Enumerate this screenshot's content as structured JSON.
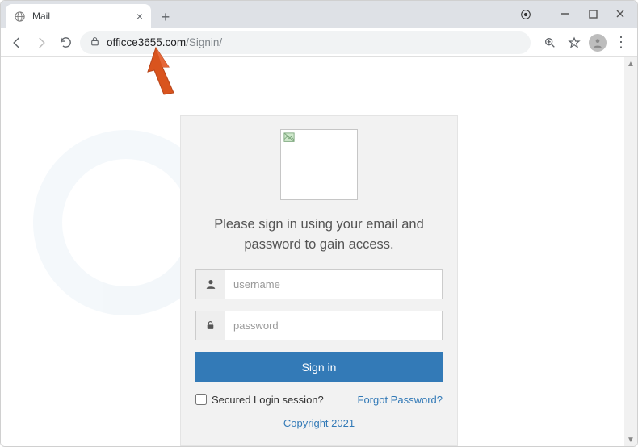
{
  "tab": {
    "title": "Mail"
  },
  "url": {
    "domain": "officce3655.com",
    "path": "/Signin/"
  },
  "page": {
    "heading": "Please sign in using your email and password to gain access.",
    "username_placeholder": "username",
    "password_placeholder": "password",
    "signin_label": "Sign in",
    "secured_label": "Secured Login session?",
    "forgot_label": "Forgot Password?",
    "copyright": "Copyright 2021"
  },
  "colors": {
    "accent": "#337ab7",
    "pointer": "#d9541e"
  }
}
